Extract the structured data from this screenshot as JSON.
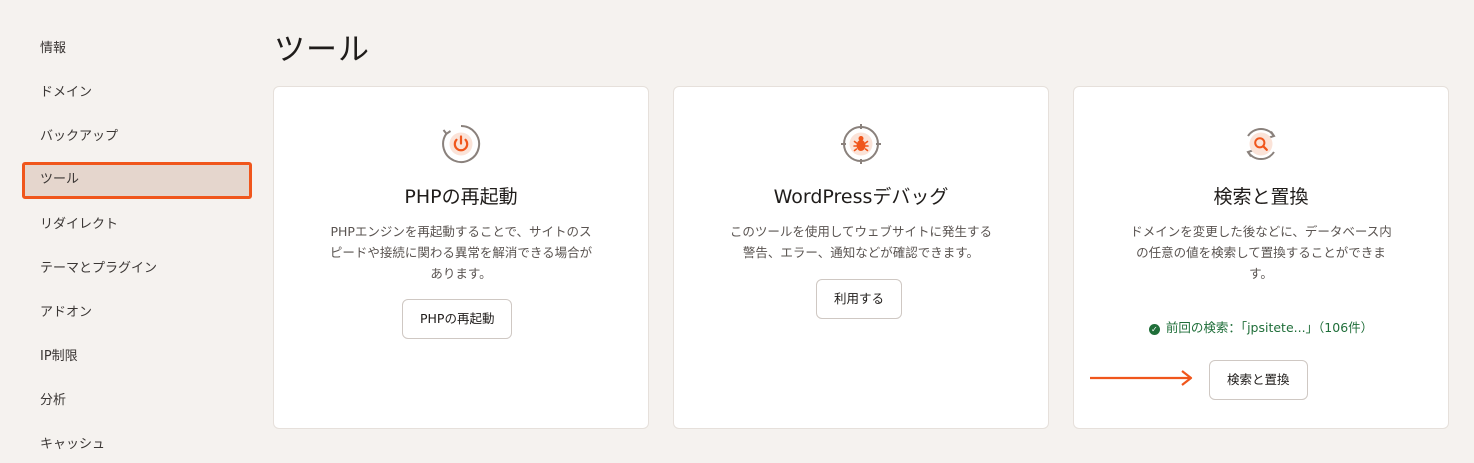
{
  "sidebar": {
    "items": [
      {
        "label": "情報"
      },
      {
        "label": "ドメイン"
      },
      {
        "label": "バックアップ"
      },
      {
        "label": "ツール"
      },
      {
        "label": "リダイレクト"
      },
      {
        "label": "テーマとプラグイン"
      },
      {
        "label": "アドオン"
      },
      {
        "label": "IP制限"
      },
      {
        "label": "分析"
      },
      {
        "label": "キャッシュ"
      }
    ],
    "active_index": 3
  },
  "page": {
    "title": "ツール"
  },
  "cards": [
    {
      "icon": "power-icon",
      "title": "PHPの再起動",
      "desc_lines": [
        "PHPエンジンを再起動することで、サイトのス",
        "ピードや接続に関わる異常を解消できる場合が",
        "あります。"
      ],
      "button": "PHPの再起動"
    },
    {
      "icon": "bug-icon",
      "title": "WordPressデバッグ",
      "desc_lines": [
        "このツールを使用してウェブサイトに発生する",
        "警告、エラー、通知などが確認できます。"
      ],
      "button": "利用する"
    },
    {
      "icon": "search-replace-icon",
      "title": "検索と置換",
      "desc_lines": [
        "ドメインを変更した後などに、データベース内",
        "の任意の値を検索して置換することができま",
        "す。"
      ],
      "status": "前回の検索：「jpsitete...」（106件）",
      "button": "検索と置換"
    }
  ],
  "colors": {
    "accent": "#f0561c",
    "success": "#1f6e39",
    "active_bg": "#e5d6cd",
    "page_bg": "#f5f2ef"
  }
}
